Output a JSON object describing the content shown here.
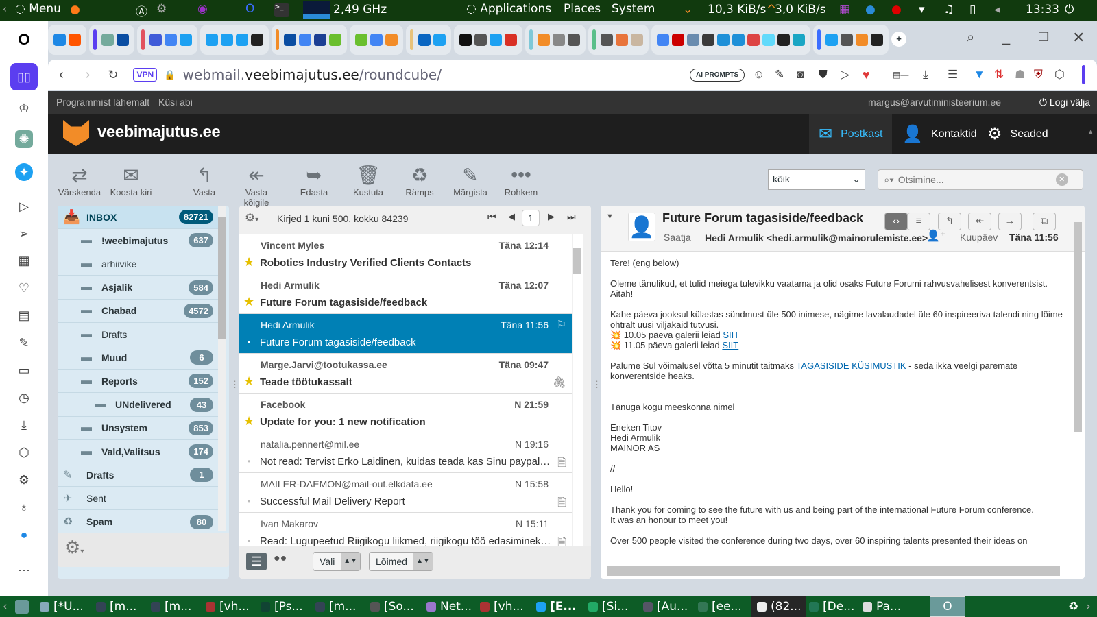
{
  "os_bar": {
    "menu": "Menu",
    "cpu": "2,49 GHz",
    "applications": "Applications",
    "places": "Places",
    "system": "System",
    "down": "10,3 KiB/s",
    "up": "3,0 KiB/s",
    "clock": "13:33"
  },
  "tabs": {
    "favicons": [
      "#1e88e5",
      "#ff5500",
      "#74aa9c",
      "#0a4da2",
      "#3f5bd8",
      "#4285f4",
      "#1da1f2",
      "#1da1f2",
      "#1da1f2",
      "#1da1f2",
      "#222",
      "#0a4da2",
      "#4285f4",
      "#1c3f94",
      "#6abf2e",
      "#6abf2e",
      "#4285f4",
      "#f28c28",
      "#0a66c2",
      "#1da1f2",
      "#111",
      "#555",
      "#1da1f2",
      "#d93025",
      "#f28c28",
      "#888",
      "#555",
      "#555",
      "#e8743b",
      "#c9b6a0",
      "#4285f4",
      "#c00",
      "#6a8caf",
      "#3a3a3a",
      "#1e90d8",
      "#1e90d8",
      "#d44",
      "#61dafb",
      "#222",
      "#1aa6c4",
      "#1da1f2",
      "#555",
      "#f28c28",
      "#222"
    ],
    "new_tab": "+"
  },
  "address_bar": {
    "vpn": "VPN",
    "url_sub": "webmail.",
    "url_domain": "veebimajutus.ee",
    "url_path": "/roundcube/",
    "ai_prompts": "AI PROMPTS"
  },
  "roundcube": {
    "top_links": {
      "about": "Programmist lähemalt",
      "help": "Küsi abi",
      "user": "margus@arvutiministeerium.ee",
      "logout": "Logi välja"
    },
    "logo": "veebimajutus.ee",
    "nav": {
      "mail": "Postkast",
      "contacts": "Kontaktid",
      "settings": "Seaded"
    },
    "toolbar": [
      "Värskenda",
      "Koosta kiri",
      "Vasta",
      "Vasta kõigile",
      "Edasta",
      "Kustuta",
      "Rämps",
      "Märgista",
      "Rohkem"
    ],
    "search_scope": "kõik",
    "search_placeholder": "Otsimine...",
    "folders": [
      {
        "name": "INBOX",
        "count": "82721",
        "level": 0,
        "bold": true,
        "icon": "inbox-icon"
      },
      {
        "name": "!weebimajutus",
        "count": "637",
        "level": 1,
        "bold": true,
        "icon": "folder-icon"
      },
      {
        "name": "arhiivike",
        "count": "",
        "level": 1,
        "bold": false,
        "icon": "folder-icon"
      },
      {
        "name": "Asjalik",
        "count": "584",
        "level": 1,
        "bold": true,
        "icon": "folder-icon"
      },
      {
        "name": "Chabad",
        "count": "4572",
        "level": 1,
        "bold": true,
        "icon": "folder-icon"
      },
      {
        "name": "Drafts",
        "count": "",
        "level": 1,
        "bold": false,
        "icon": "folder-icon"
      },
      {
        "name": "Muud",
        "count": "6",
        "level": 1,
        "bold": true,
        "icon": "folder-icon"
      },
      {
        "name": "Reports",
        "count": "152",
        "level": 1,
        "bold": true,
        "icon": "folder-icon"
      },
      {
        "name": "UNdelivered",
        "count": "43",
        "level": 2,
        "bold": true,
        "icon": "folder-icon"
      },
      {
        "name": "Unsystem",
        "count": "853",
        "level": 1,
        "bold": true,
        "icon": "folder-icon"
      },
      {
        "name": "Vald,Valitsus",
        "count": "174",
        "level": 1,
        "bold": true,
        "icon": "folder-icon"
      },
      {
        "name": "Drafts",
        "count": "1",
        "level": 0,
        "bold": true,
        "icon": "pencil-icon"
      },
      {
        "name": "Sent",
        "count": "",
        "level": 0,
        "bold": false,
        "icon": "sent-icon"
      },
      {
        "name": "Spam",
        "count": "80",
        "level": 0,
        "bold": true,
        "icon": "spam-icon"
      }
    ],
    "list": {
      "count_text": "Kirjed 1 kuni 500, kokku 84239",
      "page": "1",
      "select_label": "Vali",
      "threads_label": "Lõimed",
      "messages": [
        {
          "from": "Vincent Myles",
          "date": "Täna 12:14",
          "subject": "Robotics Industry Verified Clients Contacts",
          "unread": true,
          "flag": "star",
          "att": ""
        },
        {
          "from": "Hedi Armulik",
          "date": "Täna 12:07",
          "subject": "Future Forum tagasiside/feedback",
          "unread": true,
          "flag": "star",
          "att": ""
        },
        {
          "from": "Hedi Armulik",
          "date": "Täna 11:56",
          "subject": "Future Forum tagasiside/feedback",
          "unread": false,
          "flag": "dot",
          "att": "⚐",
          "selected": true
        },
        {
          "from": "Marge.Jarvi@tootukassa.ee",
          "date": "Täna 09:47",
          "subject": "Teade töötukassalt",
          "unread": true,
          "flag": "star",
          "att": "🖇"
        },
        {
          "from": "Facebook",
          "date": "N 21:59",
          "subject": "Update for you: 1 new notification",
          "unread": true,
          "flag": "star",
          "att": ""
        },
        {
          "from": "natalia.pennert@mil.ee",
          "date": "N 19:16",
          "subject": "Not read: Tervist Erko Laidinen, kuidas teada kas Sinu paypal konto on turvaline",
          "unread": false,
          "flag": "dot",
          "att": "🗎"
        },
        {
          "from": "MAILER-DAEMON@mail-out.elkdata.ee",
          "date": "N 15:58",
          "subject": "Successful Mail Delivery Report",
          "unread": false,
          "flag": "dot",
          "att": "🗎"
        },
        {
          "from": "Ivan Makarov",
          "date": "N 15:11",
          "subject": "Read: Lugupeetud Riigikogu liikmed, riigikogu töö edasiminek ja tulevik",
          "unread": false,
          "flag": "dot",
          "att": "🗎"
        }
      ]
    },
    "message": {
      "subject": "Future Forum tagasiside/feedback",
      "from_label": "Saatja",
      "from": "Hedi Armulik <hedi.armulik@mainorulemiste.ee>",
      "date_label": "Kuupäev",
      "date": "Täna 11:56",
      "body": {
        "p1": "Tere! (eng below)",
        "p2a": "Oleme tänulikud, et tulid meiega tulevikku vaatama ja olid osaks Future Forumi rahvusvahelisest konverentsist.",
        "p2b": "Aitäh!",
        "p3": "Kahe päeva jooksul külastas sündmust üle 500 inimese, nägime lavalaudadel üle 60 inspireeriva talendi ning lõime ohtralt uusi viljakaid tutvusi.",
        "g1": "💥 10.05 päeva galerii leiad ",
        "g2": "💥 11.05 päeva galerii leiad ",
        "link": "SIIT",
        "p4a": "Palume Sul võimalusel võtta 5 minutit täitmaks ",
        "p4link": "TAGASISIDE KÜSIMUSTIK",
        "p4b": " - seda ikka veelgi paremate konverentside heaks.",
        "p5": "Tänuga kogu meeskonna nimel",
        "sig1": "Eneken Titov",
        "sig2": "Hedi Armulik",
        "sig3": "MAINOR AS",
        "sep": "//",
        "p6": "Hello!",
        "p7a": "Thank you for coming to see the future with us and being part of the international Future Forum conference.",
        "p7b": "It was an honour to meet you!",
        "p8": "Over 500 people visited the conference during two days, over 60 inspiring talents presented their ideas on"
      }
    }
  },
  "taskbar": [
    "[*U...",
    "[m...",
    "[m...",
    "[vh...",
    "[Ps...",
    "[m...",
    "[So...",
    "Net...",
    "[vh...",
    "[E...",
    "[Si...",
    "[Au...",
    "[ee...",
    "(82...",
    "[De...",
    "Pa..."
  ],
  "colors": {
    "selected": "#0080b5",
    "os_green": "#113a0e",
    "taskbar_green": "#0d5c26",
    "accent": "#37beff"
  }
}
